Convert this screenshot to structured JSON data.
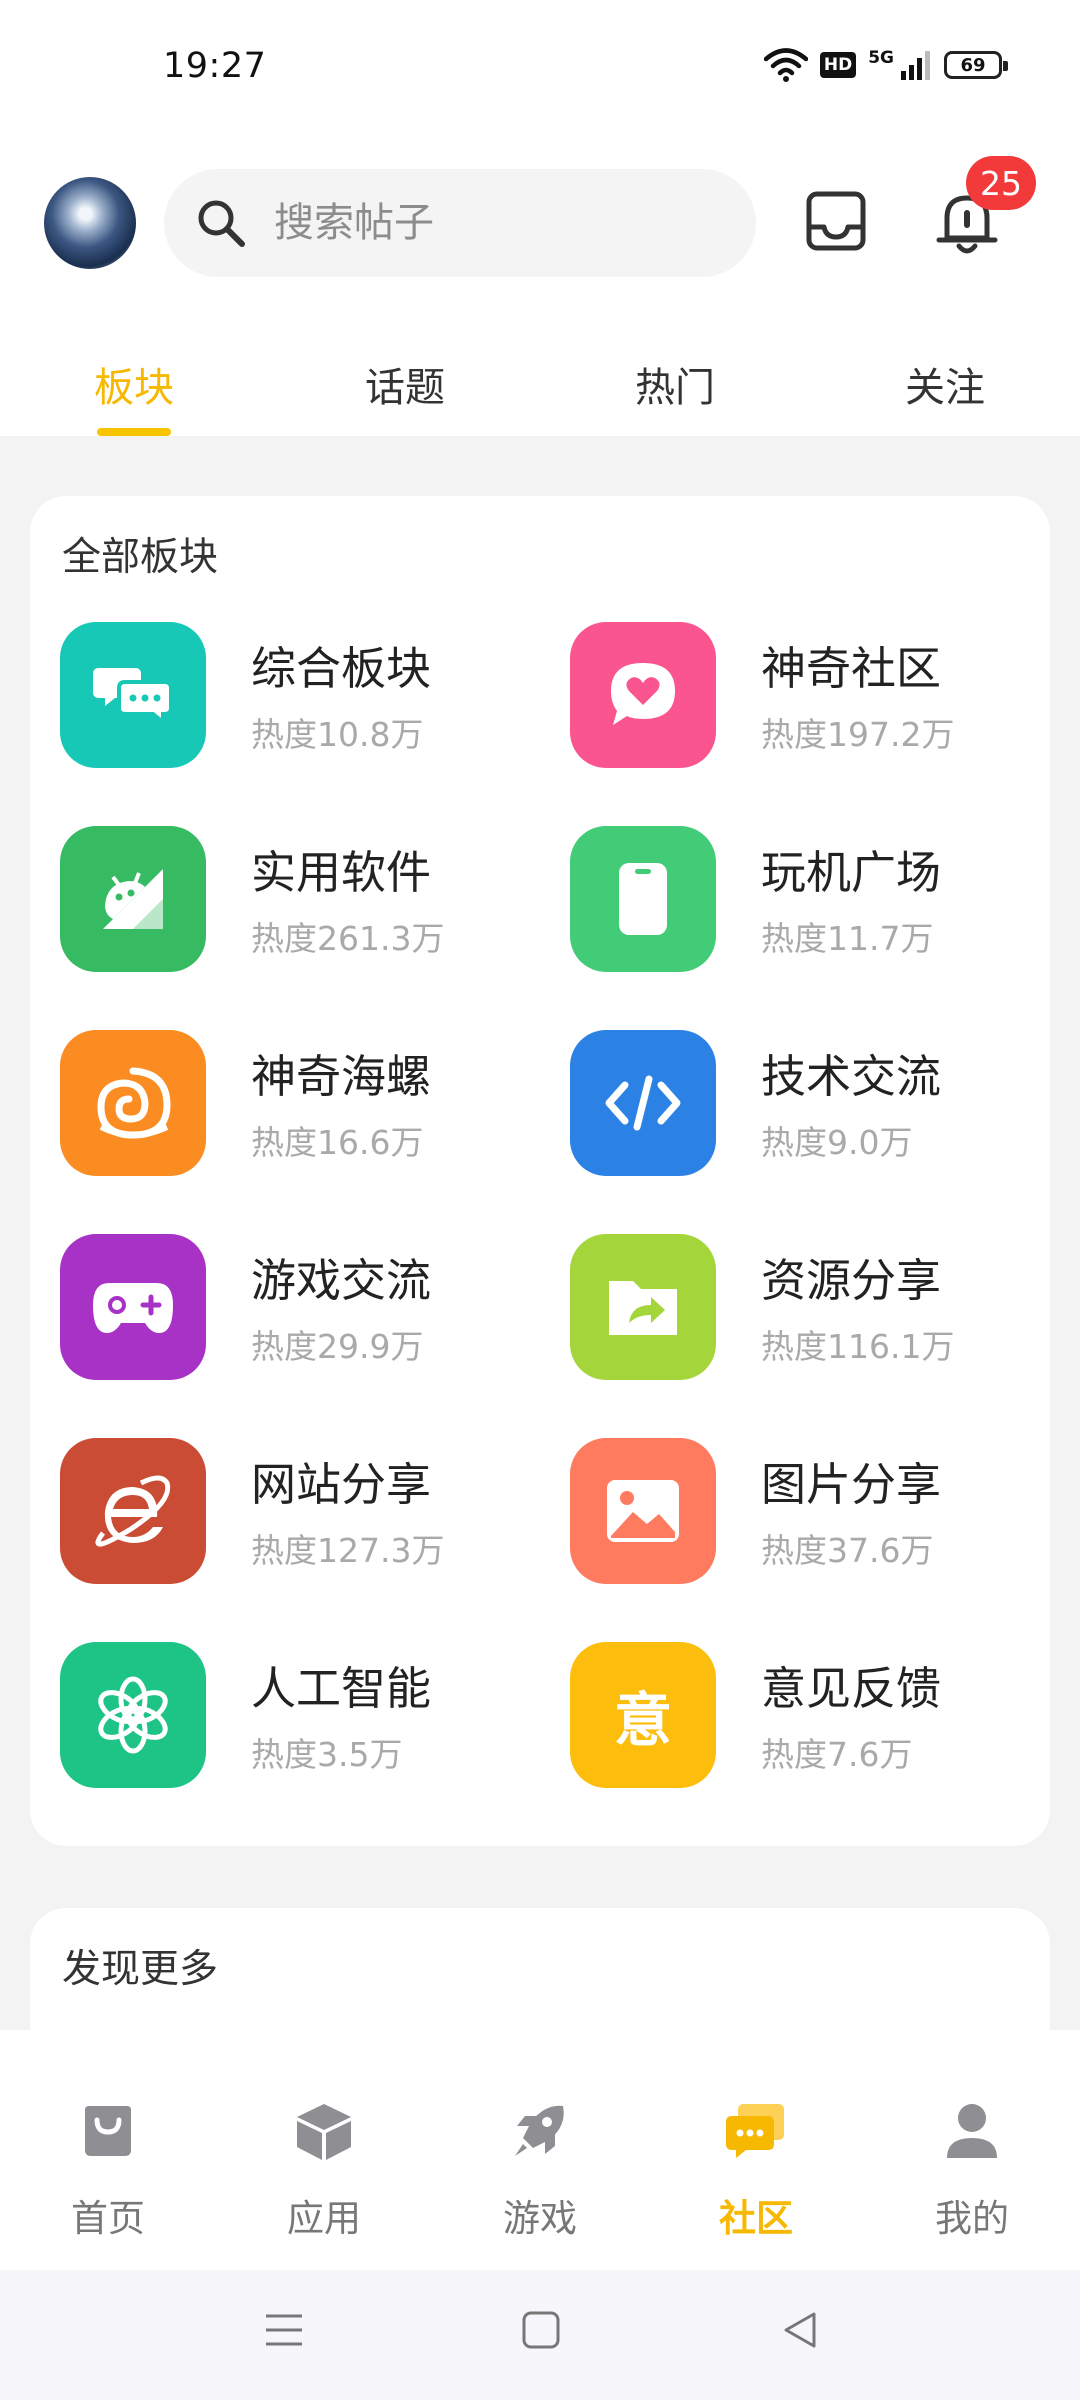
{
  "status_bar": {
    "time": "19:27",
    "hd": "HD",
    "network": "5G",
    "battery": "69"
  },
  "header": {
    "search_placeholder": "搜索帖子",
    "notification_count": "25"
  },
  "tabs": [
    {
      "label": "板块",
      "active": true
    },
    {
      "label": "话题",
      "active": false
    },
    {
      "label": "热门",
      "active": false
    },
    {
      "label": "关注",
      "active": false
    }
  ],
  "section_all": {
    "title": "全部板块",
    "forums": [
      {
        "name": "综合板块",
        "heat": "热度10.8万",
        "color": "#17c8b6",
        "icon": "chat-bubbles-icon"
      },
      {
        "name": "神奇社区",
        "heat": "热度197.2万",
        "color": "#fb5590",
        "icon": "heart-bubble-icon"
      },
      {
        "name": "实用软件",
        "heat": "热度261.3万",
        "color": "#36ba62",
        "icon": "android-icon"
      },
      {
        "name": "玩机广场",
        "heat": "热度11.7万",
        "color": "#42cc78",
        "icon": "phone-icon"
      },
      {
        "name": "神奇海螺",
        "heat": "热度16.6万",
        "color": "#fb8c22",
        "icon": "shell-icon"
      },
      {
        "name": "技术交流",
        "heat": "热度9.0万",
        "color": "#2b82e4",
        "icon": "code-icon"
      },
      {
        "name": "游戏交流",
        "heat": "热度29.9万",
        "color": "#a831c6",
        "icon": "gamepad-icon"
      },
      {
        "name": "资源分享",
        "heat": "热度116.1万",
        "color": "#a4d63c",
        "icon": "folder-share-icon"
      },
      {
        "name": "网站分享",
        "heat": "热度127.3万",
        "color": "#ca4c35",
        "icon": "browser-e-icon"
      },
      {
        "name": "图片分享",
        "heat": "热度37.6万",
        "color": "#fe7b5f",
        "icon": "image-icon"
      },
      {
        "name": "人工智能",
        "heat": "热度3.5万",
        "color": "#1ec486",
        "icon": "ai-knot-icon"
      },
      {
        "name": "意见反馈",
        "heat": "热度7.6万",
        "color": "#fcbd0c",
        "icon": "feedback-icon",
        "glyph": "意"
      }
    ]
  },
  "section_more": {
    "title": "发现更多"
  },
  "bottom_nav": [
    {
      "label": "首页",
      "icon": "bag-icon",
      "active": false
    },
    {
      "label": "应用",
      "icon": "cube-icon",
      "active": false
    },
    {
      "label": "游戏",
      "icon": "rocket-icon",
      "active": false
    },
    {
      "label": "社区",
      "icon": "community-chat-icon",
      "active": true
    },
    {
      "label": "我的",
      "icon": "person-icon",
      "active": false
    }
  ],
  "colors": {
    "accent": "#f6b800",
    "badge": "#f23a3a",
    "muted_text": "#a9a9a9",
    "nav_icon": "#8e8e93"
  }
}
